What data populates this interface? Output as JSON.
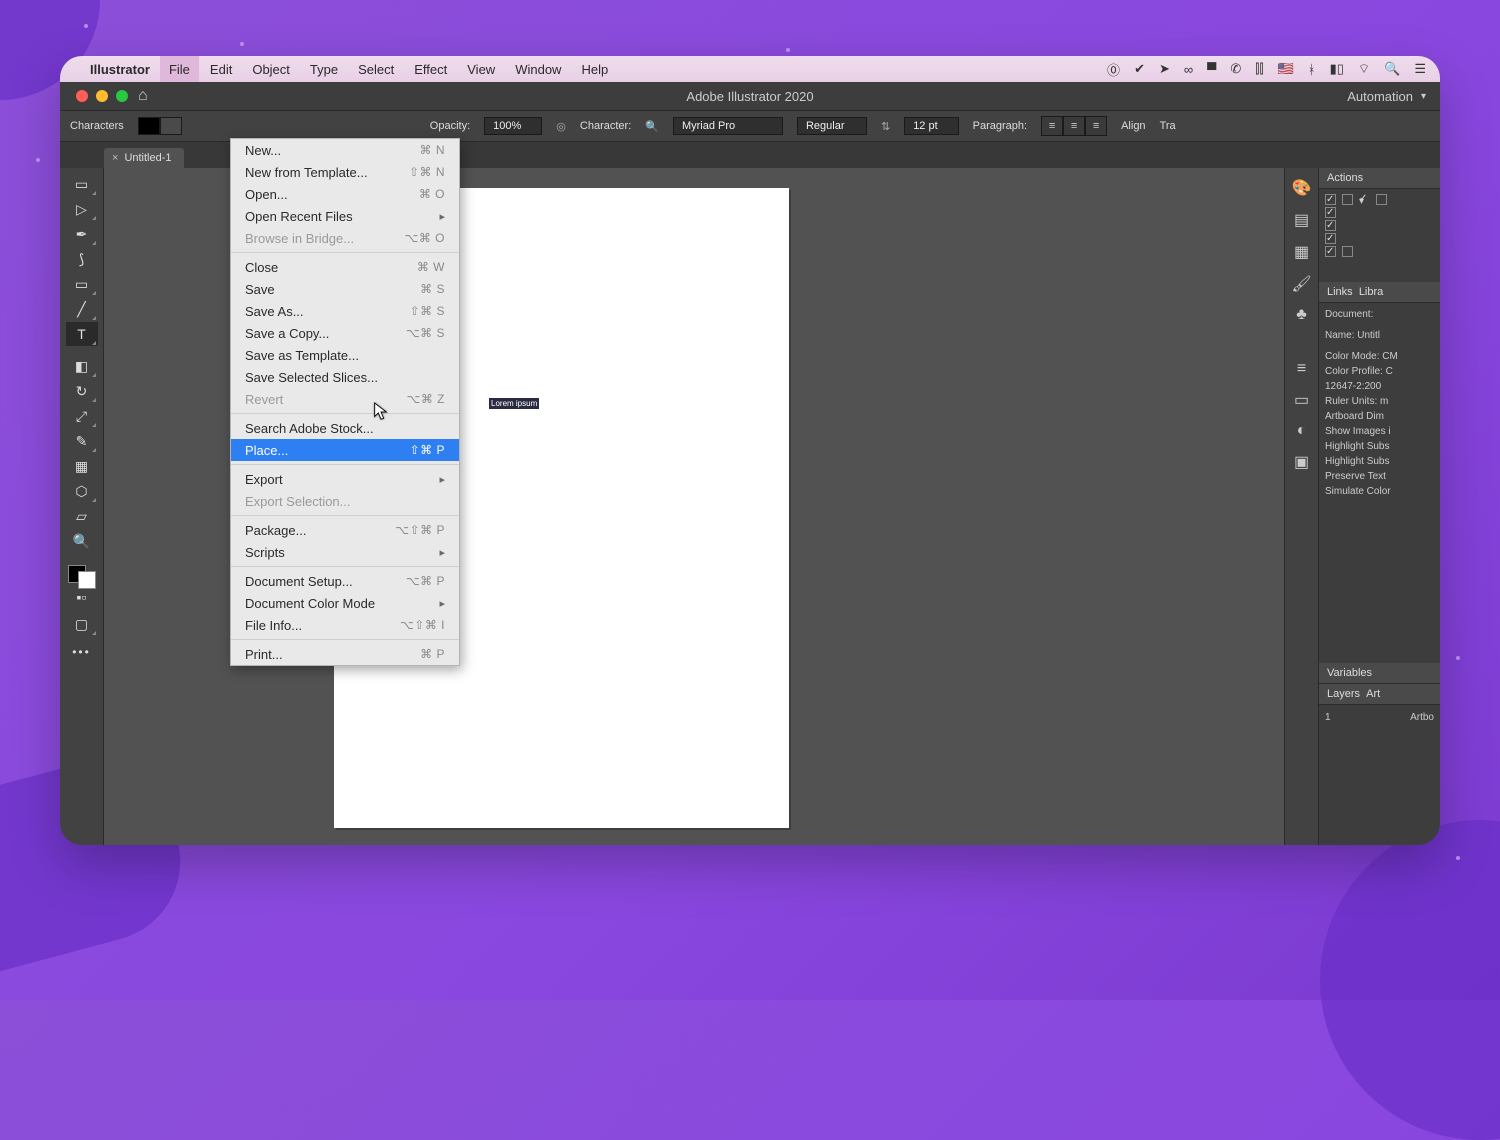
{
  "menubar": {
    "app": "Illustrator",
    "items": [
      "File",
      "Edit",
      "Object",
      "Type",
      "Select",
      "Effect",
      "View",
      "Window",
      "Help"
    ],
    "active_index": 0
  },
  "window_title": "Adobe Illustrator 2020",
  "workspace_switcher": "Automation",
  "optbar": {
    "characters": "Characters",
    "opacity_label": "Opacity:",
    "opacity_value": "100%",
    "character_label": "Character:",
    "font": "Myriad Pro",
    "style": "Regular",
    "size": "12 pt",
    "paragraph_label": "Paragraph:",
    "align_label": "Align",
    "transform_label": "Tra"
  },
  "doc_tab": {
    "name": "Untitled-1"
  },
  "artboard": {
    "placeholder_text": "Lorem ipsum"
  },
  "file_menu": [
    {
      "label": "New...",
      "shortcut": "⌘ N"
    },
    {
      "label": "New from Template...",
      "shortcut": "⇧⌘ N"
    },
    {
      "label": "Open...",
      "shortcut": "⌘ O"
    },
    {
      "label": "Open Recent Files",
      "submenu": true
    },
    {
      "label": "Browse in Bridge...",
      "shortcut": "⌥⌘ O",
      "disabled": true
    },
    {
      "separator": true
    },
    {
      "label": "Close",
      "shortcut": "⌘ W"
    },
    {
      "label": "Save",
      "shortcut": "⌘ S"
    },
    {
      "label": "Save As...",
      "shortcut": "⇧⌘ S"
    },
    {
      "label": "Save a Copy...",
      "shortcut": "⌥⌘ S"
    },
    {
      "label": "Save as Template..."
    },
    {
      "label": "Save Selected Slices..."
    },
    {
      "label": "Revert",
      "shortcut": "⌥⌘ Z",
      "disabled": true
    },
    {
      "separator": true
    },
    {
      "label": "Search Adobe Stock..."
    },
    {
      "label": "Place...",
      "shortcut": "⇧⌘ P",
      "highlighted": true
    },
    {
      "separator": true
    },
    {
      "label": "Export",
      "submenu": true
    },
    {
      "label": "Export Selection...",
      "disabled": true
    },
    {
      "separator": true
    },
    {
      "label": "Package...",
      "shortcut": "⌥⇧⌘ P"
    },
    {
      "label": "Scripts",
      "submenu": true
    },
    {
      "separator": true
    },
    {
      "label": "Document Setup...",
      "shortcut": "⌥⌘ P"
    },
    {
      "label": "Document Color Mode",
      "submenu": true
    },
    {
      "label": "File Info...",
      "shortcut": "⌥⇧⌘ I"
    },
    {
      "separator": true
    },
    {
      "label": "Print...",
      "shortcut": "⌘ P"
    }
  ],
  "right_panel": {
    "actions_title": "Actions",
    "links_title": "Links",
    "libraries_title": "Libra",
    "doc_label": "Document:",
    "name_label": "Name: Untitl",
    "info": [
      "Color Mode: CM",
      "Color Profile: C",
      "12647-2:200",
      "Ruler Units: m",
      "Artboard Dim",
      "Show Images i",
      "Highlight Subs",
      "Highlight Subs",
      "Preserve Text",
      "Simulate Color"
    ],
    "variables_title": "Variables",
    "layers_title": "Layers",
    "artboards_title": "Art",
    "layer_num": "1",
    "layer_name": "Artbo"
  }
}
